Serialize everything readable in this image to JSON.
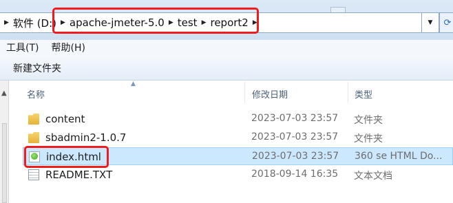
{
  "address_bar": {
    "breadcrumbs": [
      "软件 (D:)",
      "apache-jmeter-5.0",
      "test",
      "report2"
    ]
  },
  "menu": {
    "items": [
      "工具(T)",
      "帮助(H)"
    ]
  },
  "commands": {
    "new_folder": "新建文件夹"
  },
  "columns": {
    "name": "名称",
    "date_modified": "修改日期",
    "type": "类型"
  },
  "files": [
    {
      "name": "content",
      "date": "2023-07-03 23:57",
      "type": "文件夹",
      "icon": "folder-icon"
    },
    {
      "name": "sbadmin2-1.0.7",
      "date": "2023-07-03 23:57",
      "type": "文件夹",
      "icon": "folder-icon"
    },
    {
      "name": "index.html",
      "date": "2023-07-03 23:57",
      "type": "360 se HTML Do...",
      "icon": "html-file-icon",
      "selected": true
    },
    {
      "name": "README.TXT",
      "date": "2018-09-14 16:35",
      "type": "文本文档",
      "icon": "text-file-icon"
    }
  ],
  "colors": {
    "highlight_border": "#ee1c1c",
    "selection": "#cce8ff",
    "header_text": "#4c607a"
  }
}
